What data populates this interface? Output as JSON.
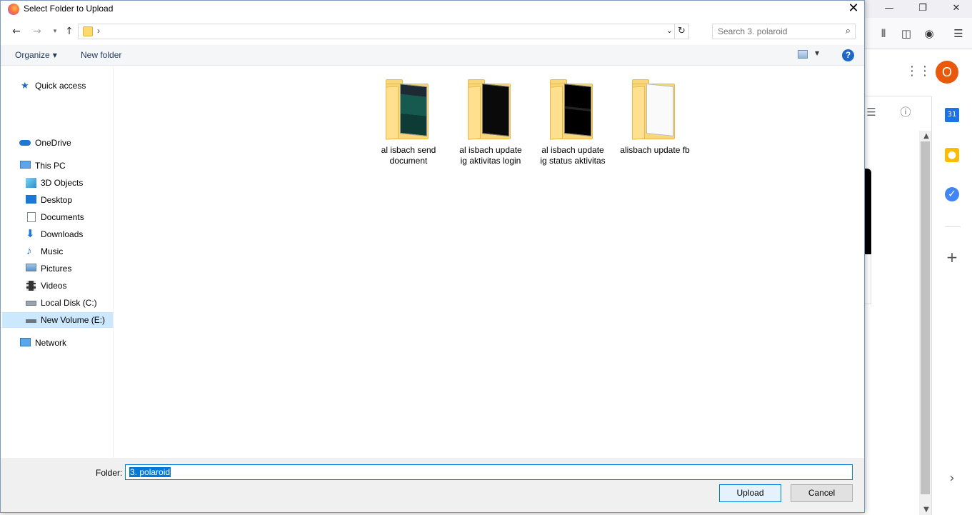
{
  "dialog": {
    "title": "Select Folder to Upload",
    "close_glyph": "✕",
    "address": {
      "separator": "›",
      "dropdown_glyph": "⌄",
      "refresh_glyph": "↻"
    },
    "search": {
      "placeholder": "Search 3. polaroid"
    },
    "toolbar": {
      "organize_label": "Organize",
      "new_folder_label": "New folder",
      "help_glyph": "?"
    },
    "nav": {
      "quick_access": "Quick access",
      "onedrive": "OneDrive",
      "this_pc": "This PC",
      "objects_3d": "3D Objects",
      "desktop": "Desktop",
      "documents": "Documents",
      "downloads": "Downloads",
      "music": "Music",
      "pictures": "Pictures",
      "videos": "Videos",
      "local_disk": "Local Disk (C:)",
      "new_volume": "New Volume (E:)",
      "network": "Network"
    },
    "folders": [
      {
        "name": "al isbach send document"
      },
      {
        "name": "al isbach update ig aktivitas login"
      },
      {
        "name": "al isbach update ig status aktivitas"
      },
      {
        "name": "alisbach update fb"
      }
    ],
    "footer": {
      "folder_label": "Folder:",
      "folder_value": "3. polaroid",
      "upload_label": "Upload",
      "cancel_label": "Cancel"
    }
  },
  "browser": {
    "avatar_letter": "O",
    "calendar_day": "31"
  }
}
